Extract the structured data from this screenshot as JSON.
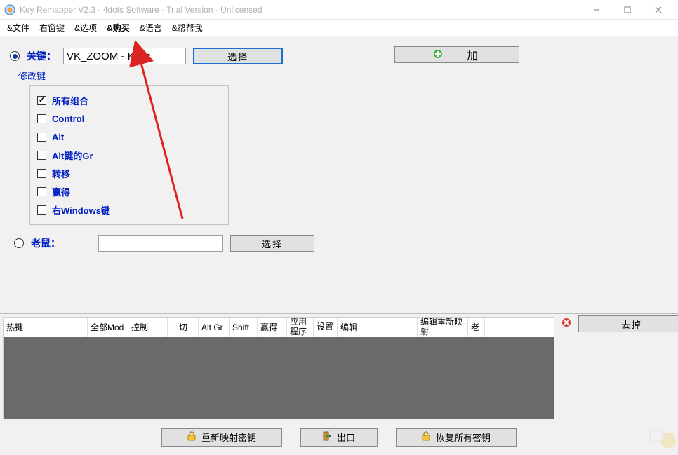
{
  "window": {
    "title": "Key Remapper V2.3 - 4dots Software - Trial Version - Unlicensed"
  },
  "menu": {
    "file": "&文件",
    "right_key": "右窗键",
    "options": "&选项",
    "buy": "&购买",
    "language": "&语言",
    "help": "&帮帮我"
  },
  "key_section": {
    "radio_label": "关键：",
    "key_value": "VK_ZOOM - Keyc",
    "select_label": "选择"
  },
  "add_button": {
    "label": "加"
  },
  "modifiers": {
    "title": "修改键",
    "all_combo": {
      "checked": true,
      "label": "所有组合"
    },
    "control": {
      "checked": false,
      "label": "Control"
    },
    "alt": {
      "checked": false,
      "label": "Alt"
    },
    "altgr": {
      "checked": false,
      "label": "Alt键的Gr"
    },
    "shift": {
      "checked": false,
      "label": "转移"
    },
    "win": {
      "checked": false,
      "label": "赢得"
    },
    "rwin": {
      "checked": false,
      "label": "右Windows键"
    }
  },
  "mouse_section": {
    "radio_label": "老鼠：",
    "select_label": "选择"
  },
  "table": {
    "cols": [
      "热键",
      "全部Mod",
      "控制",
      "一切",
      "Alt Gr",
      "Shift",
      "赢得",
      "应用程序",
      "设置",
      "编辑",
      "编辑重新映射",
      "老"
    ]
  },
  "remove_button": {
    "label": "去掉"
  },
  "footer": {
    "remap": "重新映射密钥",
    "exit": "出口",
    "restore": "恢复所有密钥"
  }
}
